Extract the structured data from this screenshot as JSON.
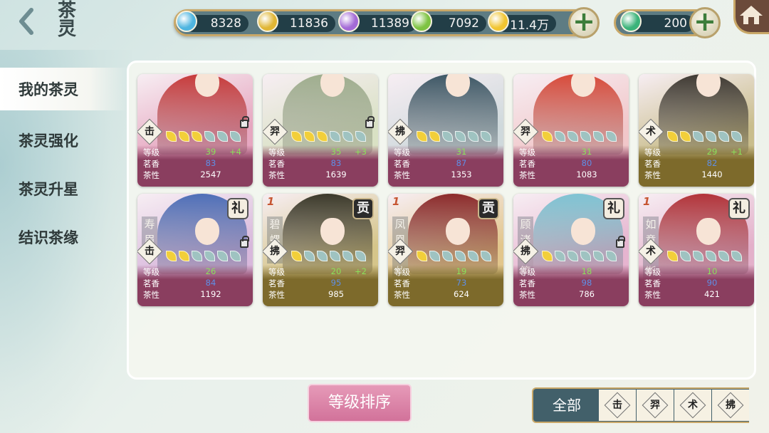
{
  "header": {
    "title_line1": "茶",
    "title_line2": "灵",
    "back": "back-arrow-icon",
    "home": "home-icon"
  },
  "currencies": [
    {
      "name": "blue-gem-icon",
      "color": "#4fb5e0",
      "value": "8328"
    },
    {
      "name": "gold-gem-icon",
      "color": "#e0b635",
      "value": "11836"
    },
    {
      "name": "purple-gem-icon",
      "color": "#a36ad6",
      "value": "11389"
    },
    {
      "name": "green-gem-icon",
      "color": "#7ec342",
      "value": "7092"
    },
    {
      "name": "gold-coin-icon",
      "color": "#f1c531",
      "value": "11.4万"
    }
  ],
  "currency2": {
    "name": "green-jade-icon",
    "color": "#3bb37a",
    "value": "200"
  },
  "sidebar": {
    "items": [
      "我的茶灵",
      "茶灵强化",
      "茶灵升星",
      "结识茶缘"
    ]
  },
  "labels": {
    "level": "等级",
    "aroma": "茗香",
    "nature": "茶性"
  },
  "cards": [
    {
      "badge": "击",
      "leaves": 3,
      "level": "39",
      "bonus": "+4",
      "aroma": "83",
      "nature": "2547",
      "locked": true,
      "bg": "#e6a7c0",
      "stat_bg": "#8a3e5f",
      "fig": "#c73b3b",
      "name": "",
      "rank": "",
      "one": ""
    },
    {
      "badge": "羿",
      "leaves": 3,
      "level": "35",
      "bonus": "+3",
      "aroma": "83",
      "nature": "1639",
      "locked": true,
      "bg": "#d9e1c4",
      "stat_bg": "#8a3e5f",
      "fig": "#9fae8e",
      "name": "",
      "rank": "",
      "one": ""
    },
    {
      "badge": "拂",
      "leaves": 2,
      "level": "31",
      "bonus": "",
      "aroma": "87",
      "nature": "1353",
      "locked": false,
      "bg": "#cfd9dc",
      "stat_bg": "#8a3e5f",
      "fig": "#3e5866",
      "name": "",
      "rank": "",
      "one": ""
    },
    {
      "badge": "羿",
      "leaves": 1,
      "level": "31",
      "bonus": "",
      "aroma": "80",
      "nature": "1083",
      "locked": false,
      "bg": "#f1c7c9",
      "stat_bg": "#8a3e5f",
      "fig": "#d84a3a",
      "name": "",
      "rank": "",
      "one": ""
    },
    {
      "badge": "术",
      "leaves": 2,
      "level": "29",
      "bonus": "+1",
      "aroma": "82",
      "nature": "1440",
      "locked": false,
      "bg": "#c9bd8c",
      "stat_bg": "#7d6a2b",
      "fig": "#3f3a33",
      "name": "",
      "rank": "",
      "one": ""
    },
    {
      "badge": "击",
      "leaves": 2,
      "level": "26",
      "bonus": "",
      "aroma": "84",
      "nature": "1192",
      "locked": true,
      "bg": "#d8b8dc",
      "stat_bg": "#8a3e5f",
      "fig": "#4f6fb8",
      "name": "寿眉",
      "rank": "礼",
      "dark": false,
      "one": ""
    },
    {
      "badge": "拂",
      "leaves": 1,
      "level": "20",
      "bonus": "+2",
      "aroma": "95",
      "nature": "985",
      "locked": false,
      "bg": "#d5c58a",
      "stat_bg": "#7d6a2b",
      "fig": "#3c3a2b",
      "name": "碧螺春",
      "rank": "贡",
      "dark": true,
      "one": "1"
    },
    {
      "badge": "羿",
      "leaves": 1,
      "level": "19",
      "bonus": "",
      "aroma": "73",
      "nature": "624",
      "locked": false,
      "bg": "#e2c68c",
      "stat_bg": "#7d6a2b",
      "fig": "#8d2c2c",
      "name": "凤凰水仙",
      "rank": "贡",
      "dark": true,
      "one": "1"
    },
    {
      "badge": "拂",
      "leaves": 1,
      "level": "18",
      "bonus": "",
      "aroma": "98",
      "nature": "786",
      "locked": true,
      "bg": "#e6b4cf",
      "stat_bg": "#8a3e5f",
      "fig": "#7fc3d3",
      "name": "顾渚紫笋",
      "rank": "礼",
      "dark": false,
      "one": ""
    },
    {
      "badge": "术",
      "leaves": 1,
      "level": "10",
      "bonus": "",
      "aroma": "90",
      "nature": "421",
      "locked": false,
      "bg": "#e3b0ca",
      "stat_bg": "#8a3e5f",
      "fig": "#b3343a",
      "name": "如意波斯",
      "rank": "礼",
      "dark": false,
      "one": "1"
    }
  ],
  "footer": {
    "sort_label": "等级排序",
    "all_label": "全部",
    "filters": [
      "击",
      "羿",
      "术",
      "拂"
    ]
  }
}
